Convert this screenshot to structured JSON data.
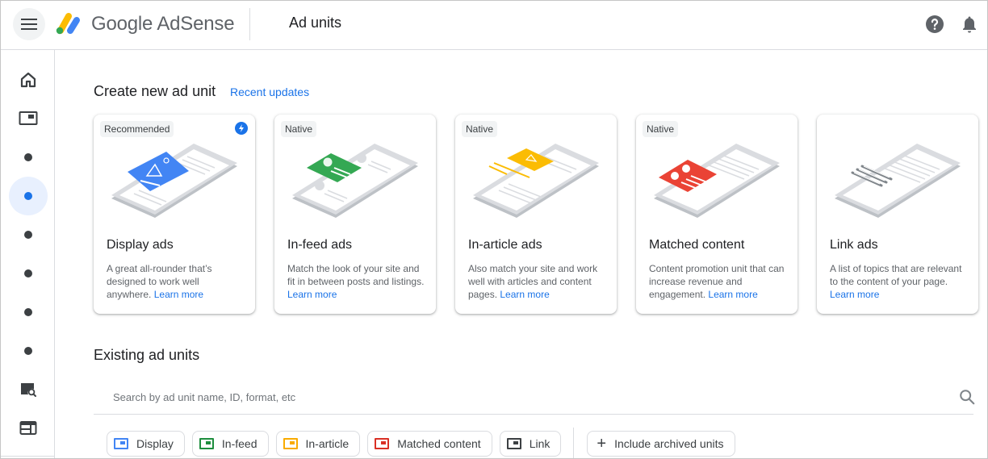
{
  "header": {
    "brand": "Google AdSense",
    "page_title": "Ad units",
    "icons": {
      "menu": "menu-icon",
      "logo": "adsense-logo",
      "help": "help-icon",
      "notifications": "bell-icon"
    }
  },
  "sidebar": {
    "items": [
      {
        "icon": "home-icon",
        "active": false
      },
      {
        "icon": "ads-icon",
        "active": false
      },
      {
        "icon": "dot-icon",
        "active": false
      },
      {
        "icon": "dot-icon",
        "active": true
      },
      {
        "icon": "dot-icon",
        "active": false
      },
      {
        "icon": "dot-icon",
        "active": false
      },
      {
        "icon": "dot-icon",
        "active": false
      },
      {
        "icon": "dot-icon",
        "active": false
      },
      {
        "icon": "policy-search-icon",
        "active": false
      },
      {
        "icon": "layout-icon",
        "active": false
      }
    ]
  },
  "create": {
    "heading": "Create new ad unit",
    "recent_updates": "Recent updates",
    "cards": [
      {
        "badge": "Recommended",
        "title": "Display ads",
        "desc": "A great all-rounder that’s designed to work well anywhere.",
        "link": "Learn more",
        "color": "#4285f4",
        "bolt": true
      },
      {
        "badge": "Native",
        "title": "In-feed ads",
        "desc": "Match the look of your site and fit in between posts and listings.",
        "link": "Learn more",
        "color": "#34a853"
      },
      {
        "badge": "Native",
        "title": "In-article ads",
        "desc": "Also match your site and work well with articles and content pages.",
        "link": "Learn more",
        "color": "#fbbc04"
      },
      {
        "badge": "Native",
        "title": "Matched content",
        "desc": "Content promotion unit that can increase revenue and engagement.",
        "link": "Learn more",
        "color": "#ea4335"
      },
      {
        "badge": "",
        "title": "Link ads",
        "desc": "A list of topics that are relevant to the content of your page.",
        "link": "Learn more",
        "color": "#9aa0a6"
      }
    ]
  },
  "existing": {
    "heading": "Existing ad units",
    "search_placeholder": "Search by ad unit name, ID, format, etc",
    "search_value": "",
    "filters": [
      {
        "label": "Display",
        "color": "#4285f4"
      },
      {
        "label": "In-feed",
        "color": "#1e8e3e"
      },
      {
        "label": "In-article",
        "color": "#f9ab00"
      },
      {
        "label": "Matched content",
        "color": "#d93025"
      },
      {
        "label": "Link",
        "color": "#3c4043"
      }
    ],
    "archived": "Include archived units"
  }
}
